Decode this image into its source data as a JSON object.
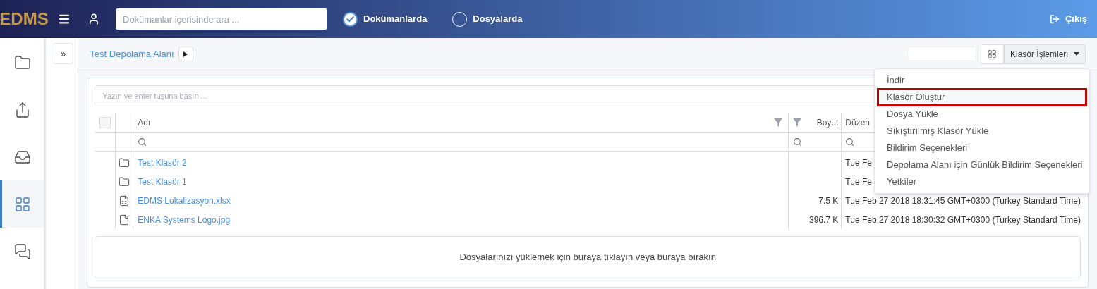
{
  "header": {
    "logo": "EDMS",
    "search": {
      "placeholder": "Dokümanlar içerisinde ara ..."
    },
    "scopes": [
      {
        "label": "Dokümanlarda",
        "selected": true
      },
      {
        "label": "Dosyalarda",
        "selected": false
      }
    ],
    "logout": "Çıkış"
  },
  "sidebar": {
    "items": [
      {
        "kind": "folder",
        "selected": false
      },
      {
        "kind": "share",
        "selected": false
      },
      {
        "kind": "inbox",
        "selected": false
      },
      {
        "kind": "grid",
        "selected": true
      },
      {
        "kind": "chat",
        "selected": false
      }
    ]
  },
  "expand_button": "»",
  "breadcrumb": {
    "items": [
      "Test Depolama Alanı"
    ]
  },
  "toolbar": {
    "actions_button": "Klasör İşlemleri"
  },
  "filter": {
    "placeholder": "Yazın ve enter tuşuna basın ..."
  },
  "table": {
    "columns": [
      "Adı",
      "Boyut",
      "Düzen"
    ],
    "checked": false,
    "rows": [
      {
        "kind": "folder",
        "name": "Test Klasör 2",
        "size": "",
        "modified": "Tue Fe"
      },
      {
        "kind": "folder",
        "name": "Test Klasör 1",
        "size": "",
        "modified": "Tue Fe"
      },
      {
        "kind": "excel",
        "name": "EDMS Lokalizasyon.xlsx",
        "size": "7.5 K",
        "modified": "Tue Feb 27 2018 18:31:45 GMT+0300 (Turkey Standard Time)"
      },
      {
        "kind": "file",
        "name": "ENKA Systems Logo.jpg",
        "size": "396.7 K",
        "modified": "Tue Feb 27 2018 18:30:32 GMT+0300 (Turkey Standard Time)"
      }
    ]
  },
  "dropzone": "Dosyalarınızı yüklemek için buraya tıklayın veya buraya bırakın",
  "menu": {
    "items": [
      {
        "label": "İndir",
        "highlighted": false
      },
      {
        "label": "Klasör Oluştur",
        "highlighted": true
      },
      {
        "label": "Dosya Yükle",
        "highlighted": false
      },
      {
        "label": "Sıkıştırılmış Klasör Yükle",
        "highlighted": false
      },
      {
        "label": "Bildirim Seçenekleri",
        "highlighted": false
      },
      {
        "label": "Depolama Alanı için Günlük Bildirim Seçenekleri",
        "highlighted": false
      },
      {
        "label": "Yetkiler",
        "highlighted": false
      }
    ]
  }
}
